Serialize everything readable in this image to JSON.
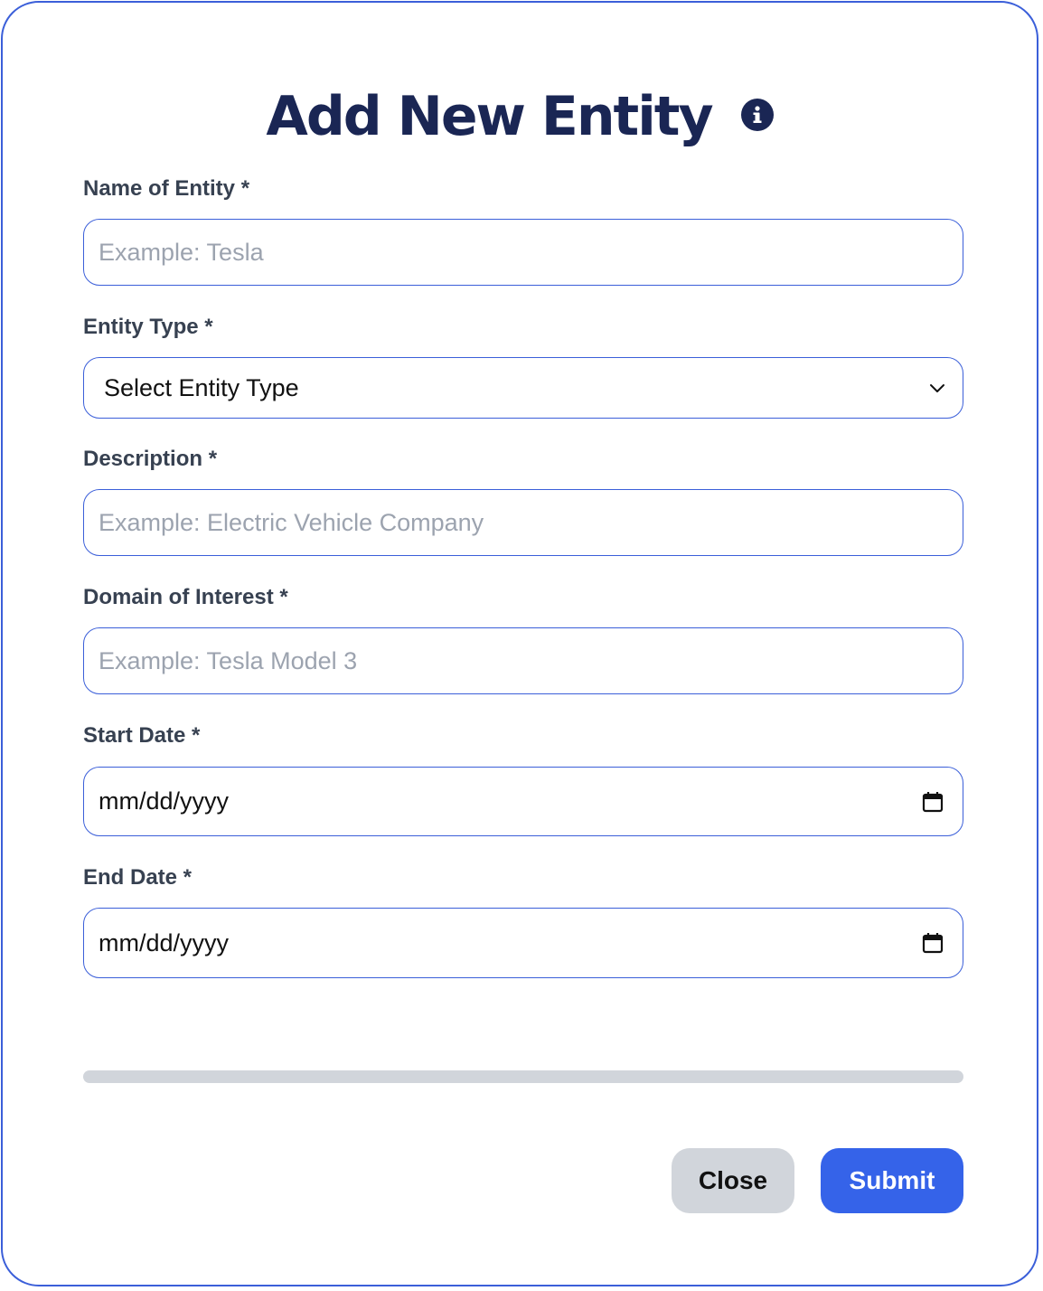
{
  "modal": {
    "title": "Add New Entity",
    "info_icon": "info-icon"
  },
  "fields": {
    "name": {
      "label": "Name of Entity *",
      "placeholder": "Example: Tesla"
    },
    "entity_type": {
      "label": "Entity Type *",
      "selected": "Select Entity Type"
    },
    "description": {
      "label": "Description *",
      "placeholder": "Example: Electric Vehicle Company"
    },
    "domain": {
      "label": "Domain of Interest *",
      "placeholder": "Example: Tesla Model 3"
    },
    "start_date": {
      "label": "Start Date *",
      "value": "mm/dd/yyyy"
    },
    "end_date": {
      "label": "End Date *",
      "value": "mm/dd/yyyy"
    }
  },
  "progress": {
    "value": 0
  },
  "buttons": {
    "close": "Close",
    "submit": "Submit"
  },
  "colors": {
    "accent": "#3b5fd9",
    "submit_bg": "#3563e9",
    "title": "#1a2654",
    "label": "#374151",
    "placeholder": "#9ca3af",
    "close_bg": "#d1d5db"
  }
}
